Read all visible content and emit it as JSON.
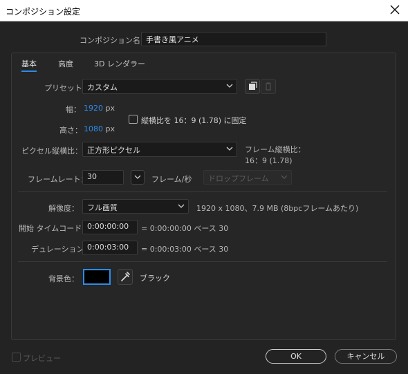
{
  "window": {
    "title": "コンポジション設定"
  },
  "comp_name": {
    "label": "コンポジション名：",
    "value": "手書き風アニメ"
  },
  "tabs": [
    {
      "label": "基本",
      "active": true
    },
    {
      "label": "高度",
      "active": false
    },
    {
      "label": "3D レンダラー",
      "active": false
    }
  ],
  "preset": {
    "label": "プリセット：",
    "value": "カスタム"
  },
  "width": {
    "label": "幅：",
    "value": "1920",
    "unit": "px"
  },
  "height": {
    "label": "高さ：",
    "value": "1080",
    "unit": "px"
  },
  "lock_aspect": {
    "label": "縦横比を 16：9 (1.78) に固定",
    "checked": false
  },
  "pixel_aspect": {
    "label": "ピクセル縦横比：",
    "value": "正方形ピクセル"
  },
  "frame_aspect": {
    "label": "フレーム縦横比：",
    "value": "16：9 (1.78)"
  },
  "frame_rate": {
    "label": "フレームレート：",
    "value": "30",
    "unit": "フレーム/秒",
    "drop_frame": "ドロップフレーム"
  },
  "resolution": {
    "label": "解像度：",
    "value": "フル画質",
    "info": "1920 x 1080、7.9 MB (8bpcフレームあたり)"
  },
  "start_timecode": {
    "label": "開始 タイムコード：",
    "value": "0:00:00:00",
    "info": "= 0:00:00:00  ベース 30"
  },
  "duration": {
    "label": "デュレーション：",
    "value": "0:00:03:00",
    "info": "= 0:00:03:00  ベース 30"
  },
  "background": {
    "label": "背景色：",
    "name": "ブラック",
    "color": "#000000"
  },
  "footer": {
    "preview_label": "プレビュー",
    "ok_label": "OK",
    "cancel_label": "キャンセル"
  },
  "colors": {
    "accent": "#2d8ceb"
  }
}
